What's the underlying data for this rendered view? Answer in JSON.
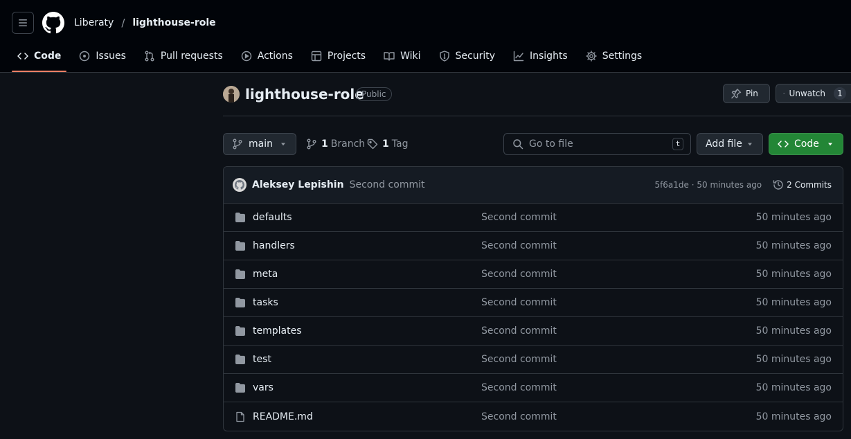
{
  "header": {
    "owner": "Liberaty",
    "separator": "/",
    "repo": "lighthouse-role"
  },
  "tabs": [
    {
      "label": "Code",
      "icon": "code-icon",
      "selected": true
    },
    {
      "label": "Issues",
      "icon": "issue-icon"
    },
    {
      "label": "Pull requests",
      "icon": "pull-request-icon"
    },
    {
      "label": "Actions",
      "icon": "play-icon"
    },
    {
      "label": "Projects",
      "icon": "table-icon"
    },
    {
      "label": "Wiki",
      "icon": "book-icon"
    },
    {
      "label": "Security",
      "icon": "shield-icon"
    },
    {
      "label": "Insights",
      "icon": "graph-icon"
    },
    {
      "label": "Settings",
      "icon": "gear-icon"
    }
  ],
  "repo": {
    "title": "lighthouse-role",
    "visibility": "Public",
    "pin_label": "Pin",
    "watch_label": "Unwatch",
    "watch_count": "1"
  },
  "toolbar": {
    "branch": "main",
    "branch_count": "1",
    "branch_label": "Branch",
    "tag_count": "1",
    "tag_label": "Tag",
    "search_placeholder": "Go to file",
    "search_shortcut": "t",
    "add_file_label": "Add file",
    "code_label": "Code"
  },
  "latest_commit": {
    "author": "Aleksey Lepishin",
    "message": "Second commit",
    "hash_time": "5f6a1de · 50 minutes ago",
    "commits_label": "2 Commits"
  },
  "files": [
    {
      "name": "defaults",
      "type": "folder",
      "commit": "Second commit",
      "time": "50 minutes ago"
    },
    {
      "name": "handlers",
      "type": "folder",
      "commit": "Second commit",
      "time": "50 minutes ago"
    },
    {
      "name": "meta",
      "type": "folder",
      "commit": "Second commit",
      "time": "50 minutes ago"
    },
    {
      "name": "tasks",
      "type": "folder",
      "commit": "Second commit",
      "time": "50 minutes ago"
    },
    {
      "name": "templates",
      "type": "folder",
      "commit": "Second commit",
      "time": "50 minutes ago"
    },
    {
      "name": "test",
      "type": "folder",
      "commit": "Second commit",
      "time": "50 minutes ago"
    },
    {
      "name": "vars",
      "type": "folder",
      "commit": "Second commit",
      "time": "50 minutes ago"
    },
    {
      "name": "README.md",
      "type": "file",
      "commit": "Second commit",
      "time": "50 minutes ago"
    }
  ],
  "colors": {
    "background": "#0d1117",
    "header_bg": "#010409",
    "tab_underline": "#f78166",
    "code_button": "#238636"
  }
}
